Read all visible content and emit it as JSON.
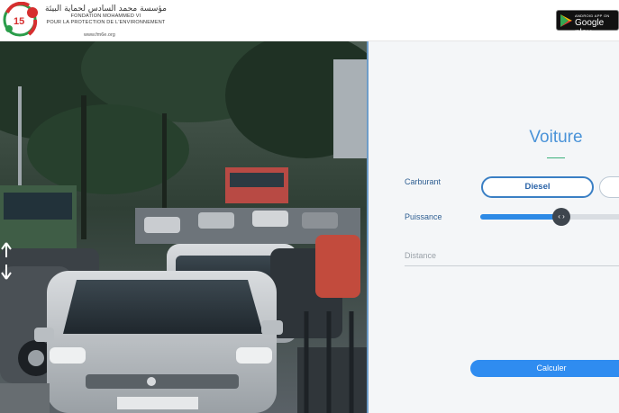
{
  "header": {
    "logo_arabic": "مؤسسة محمد السادس لحماية البيئة",
    "logo_french_line1": "FONDATION MOHAMMED VI",
    "logo_french_line2": "POUR LA PROTECTION DE L'ENVIRONNEMENT",
    "logo_url": "www.fm6e.org",
    "store_badge_small": "ANDROID APP ON",
    "store_badge_big": "Google play"
  },
  "form": {
    "title": "Voiture",
    "carburant_label": "Carburant",
    "carburant_value": "Diesel",
    "puissance_label": "Puissance",
    "puissance_level": 0.56,
    "distance_placeholder": "Distance",
    "submit_label": "Calculer"
  },
  "colors": {
    "accent": "#2f8cf0",
    "title": "#4a93d8",
    "label": "#2f5f92",
    "rule": "#3ab07a"
  },
  "icons": {
    "logo": "fm6e-logo-icon",
    "play": "google-play-icon",
    "slider_thumb": "chevrons-left-right-icon",
    "side_arrows": "up-down-arrows-icon"
  }
}
